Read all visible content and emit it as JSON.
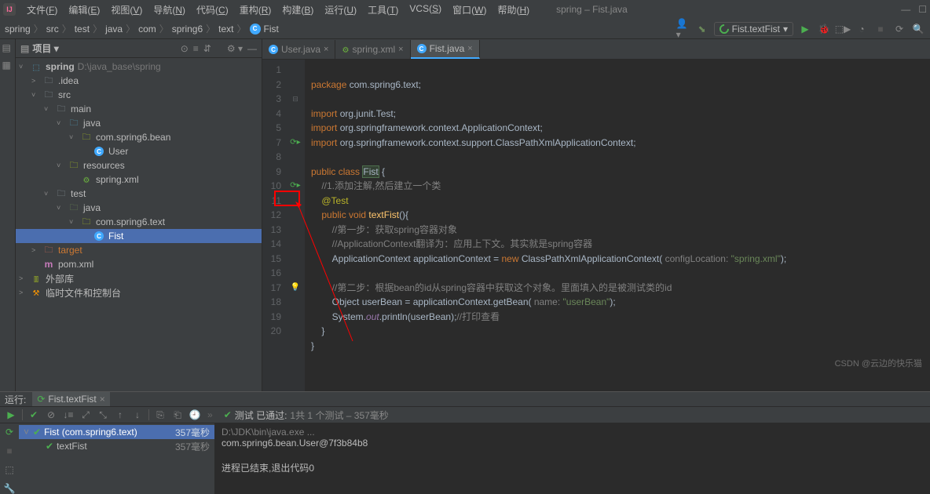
{
  "titlebar": {
    "menus": [
      "文件(F)",
      "编辑(E)",
      "视图(V)",
      "导航(N)",
      "代码(C)",
      "重构(R)",
      "构建(B)",
      "运行(U)",
      "工具(T)",
      "VCS(S)",
      "窗口(W)",
      "帮助(H)"
    ],
    "wintitle": "spring – Fist.java"
  },
  "breadcrumb": {
    "items": [
      "spring",
      "src",
      "test",
      "java",
      "com",
      "spring6",
      "text"
    ],
    "fileicon": "C",
    "file": "Fist"
  },
  "runcombo": {
    "label": "Fist.textFist"
  },
  "project": {
    "panel_title": "项目",
    "root": {
      "name": "spring",
      "path": "D:\\java_base\\spring"
    },
    "tree": [
      {
        "indent": 1,
        "arrow": "˃",
        "icon": "folder",
        "label": ".idea"
      },
      {
        "indent": 1,
        "arrow": "˅",
        "icon": "folder",
        "label": "src"
      },
      {
        "indent": 2,
        "arrow": "˅",
        "icon": "folder",
        "label": "main"
      },
      {
        "indent": 3,
        "arrow": "˅",
        "icon": "folder",
        "label": "java",
        "cls": "blue"
      },
      {
        "indent": 4,
        "arrow": "˅",
        "icon": "pkg",
        "label": "com.spring6.bean"
      },
      {
        "indent": 5,
        "arrow": "",
        "icon": "class",
        "label": "User"
      },
      {
        "indent": 3,
        "arrow": "˅",
        "icon": "folder",
        "label": "resources",
        "cls": "res"
      },
      {
        "indent": 4,
        "arrow": "",
        "icon": "xml",
        "label": "spring.xml"
      },
      {
        "indent": 2,
        "arrow": "˅",
        "icon": "folder",
        "label": "test"
      },
      {
        "indent": 3,
        "arrow": "˅",
        "icon": "folder",
        "label": "java",
        "cls": "green"
      },
      {
        "indent": 4,
        "arrow": "˅",
        "icon": "pkg",
        "label": "com.spring6.text"
      },
      {
        "indent": 5,
        "arrow": "",
        "icon": "class",
        "label": "Fist",
        "selected": true
      },
      {
        "indent": 1,
        "arrow": "˃",
        "icon": "target",
        "label": "target",
        "orange": true
      },
      {
        "indent": 1,
        "arrow": "",
        "icon": "pom",
        "label": "pom.xml"
      }
    ],
    "extlibs": "外部库",
    "scratches": "临时文件和控制台"
  },
  "tabs": [
    {
      "icon": "C",
      "label": "User.java",
      "active": false
    },
    {
      "icon": "xml",
      "label": "spring.xml",
      "active": false
    },
    {
      "icon": "C",
      "label": "Fist.java",
      "active": true
    }
  ],
  "code": {
    "lines": [
      1,
      2,
      3,
      4,
      5,
      7,
      8,
      9,
      10,
      11,
      12,
      13,
      14,
      15,
      16,
      17,
      18,
      19,
      20
    ],
    "content": {
      "l1_pkg": "package",
      "l1_pkgv": "com.spring6.text",
      "l3_imp": "import",
      "l3_v": "org.junit.Test",
      "l4_v": "org.springframework.context.ApplicationContext",
      "l5_v": "org.springframework.context.support.ClassPathXmlApplicationContext",
      "l7_pub": "public class",
      "l7_cls": "Fist",
      "l7_b": " {",
      "l8_c": "//1.添加注解,然后建立一个类",
      "l9_a": "@Test",
      "l10_1": "public void",
      "l10_2": "textFist",
      "l10_3": "(){",
      "l11_c": "//第一步：获取spring容器对象",
      "l12_c": "//ApplicationContext翻译为：应用上下文。其实就是spring容器",
      "l13_1": "ApplicationContext applicationContext = ",
      "l13_new": "new",
      "l13_2": " ClassPathXmlApplicationContext(",
      "l13_p": " configLocation:",
      "l13_s": " \"spring.xml\"",
      "l13_3": ");",
      "l15_c": "//第二步：根据bean的id从spring容器中获取这个对象。里面填入的是被测试类的id",
      "l16_1": "Object userBean = applicationContext.getBean(",
      "l16_p": " name:",
      "l16_s": " \"userBean\"",
      "l16_2": ");",
      "l17_1": "System.",
      "l17_out": "out",
      "l17_2": ".println(userBean);",
      "l17_c": "//打印查看",
      "l18": "}",
      "l19": "}"
    }
  },
  "run": {
    "label": "运行:",
    "tab": "Fist.textFist",
    "status_pre": "测试 已通过:",
    "status_post": "1共 1 个测试 – 357毫秒",
    "tree": [
      {
        "label": "Fist (com.spring6.text)",
        "time": "357毫秒",
        "selected": true,
        "indent": 0,
        "arrow": "˅"
      },
      {
        "label": "textFist",
        "time": "357毫秒",
        "indent": 1,
        "arrow": ""
      }
    ],
    "console": {
      "cmd": "D:\\JDK\\bin\\java.exe ...",
      "out": "com.spring6.bean.User@7f3b84b8",
      "exit": "进程已结束,退出代码0"
    }
  },
  "watermark": "CSDN @云边的快乐猫"
}
